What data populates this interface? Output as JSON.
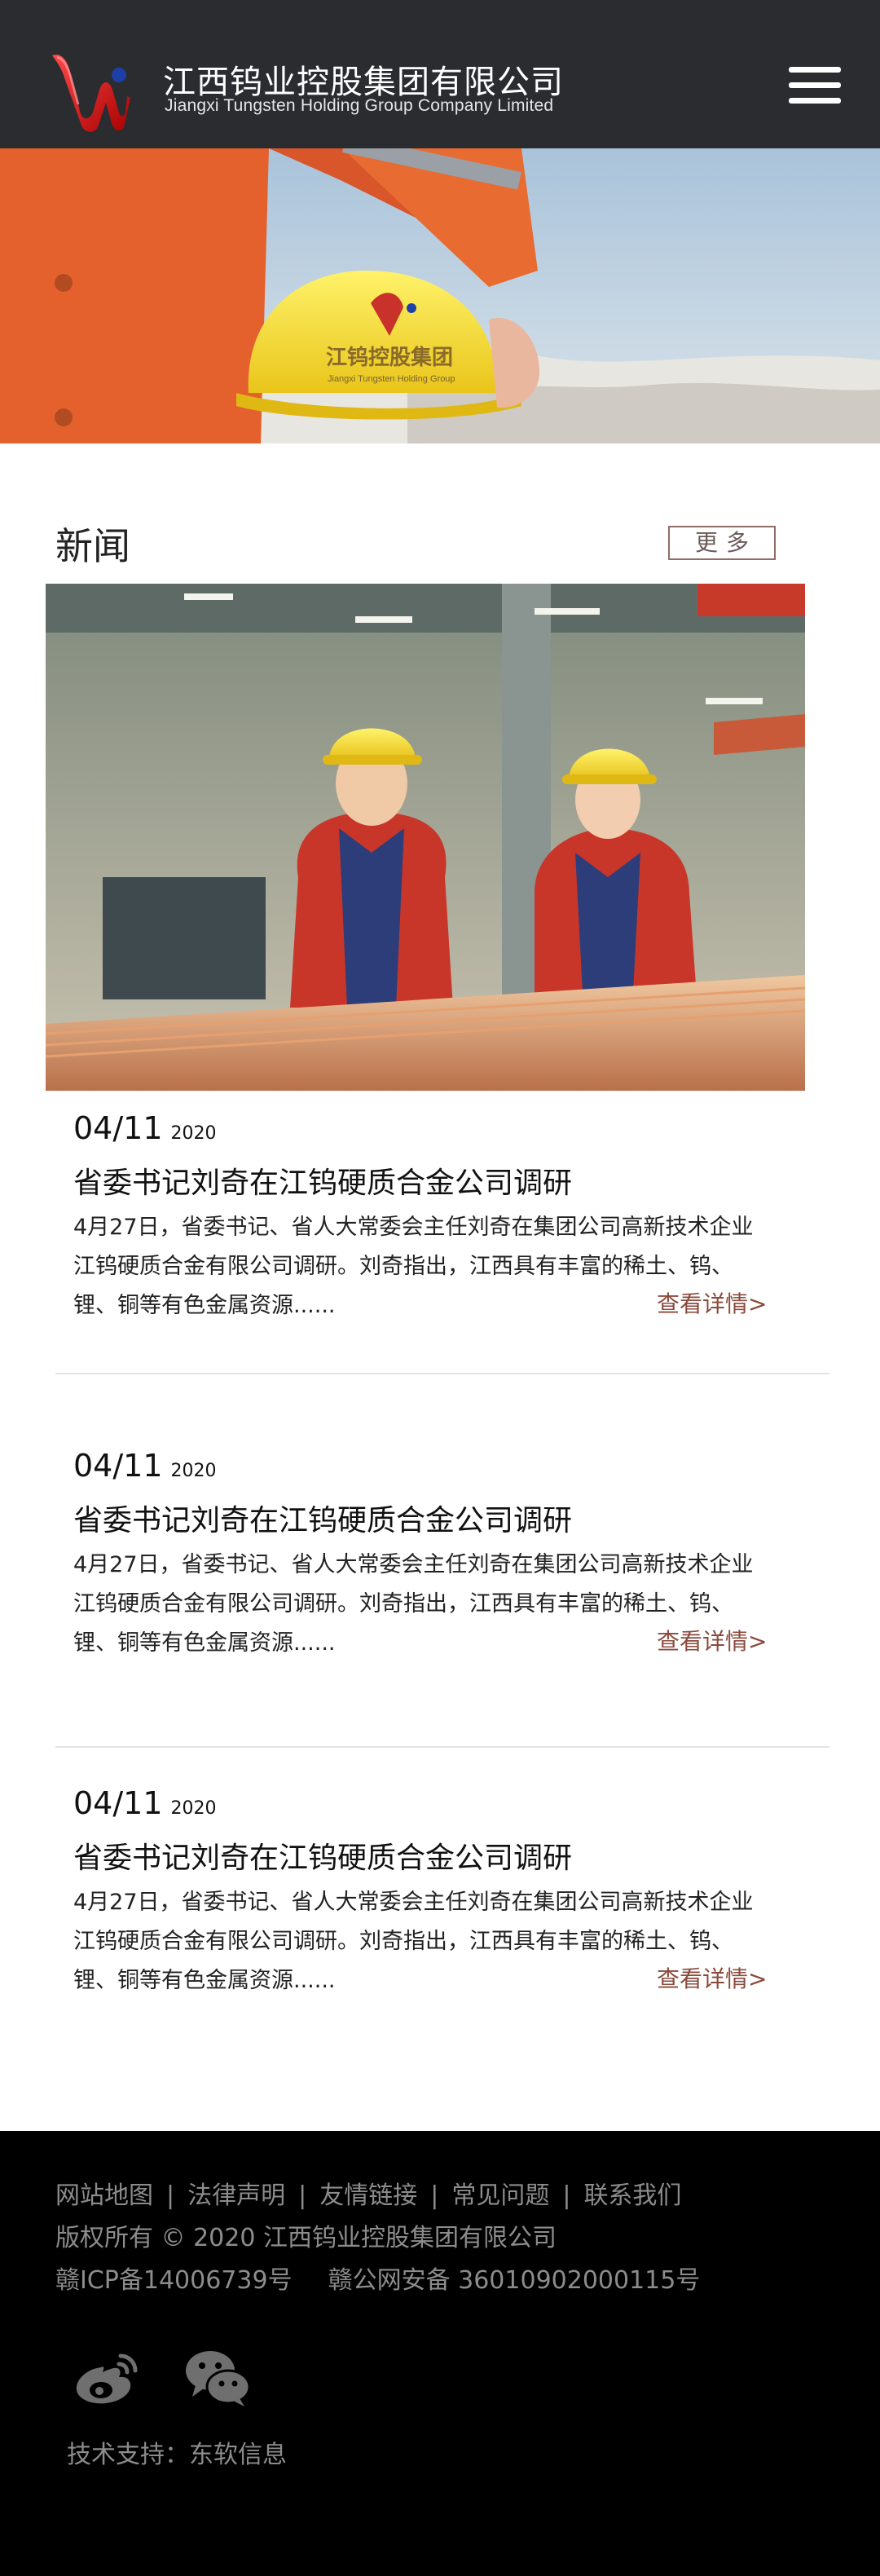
{
  "header": {
    "company_cn": "江西钨业控股集团有限公司",
    "company_en": "Jiangxi Tungsten Holding Group Company Limited",
    "helmet_text": "江钨控股集团",
    "helmet_text_en": "Jiangxi Tungsten Holding Group"
  },
  "news": {
    "title": "新闻",
    "more_label": "更多",
    "items": [
      {
        "date": "04/11",
        "year": "2020",
        "title": "省委书记刘奇在江钨硬质合金公司调研",
        "summary": "4月27日，省委书记、省人大常委会主任刘奇在集团公司高新技术企业江钨硬质合金有限公司调研。刘奇指出，江西具有丰富的稀土、钨、锂、铜等有色金属资源......",
        "more": "查看详情>"
      },
      {
        "date": "04/11",
        "year": "2020",
        "title": "省委书记刘奇在江钨硬质合金公司调研",
        "summary": "4月27日，省委书记、省人大常委会主任刘奇在集团公司高新技术企业江钨硬质合金有限公司调研。刘奇指出，江西具有丰富的稀土、钨、锂、铜等有色金属资源......",
        "more": "查看详情>"
      },
      {
        "date": "04/11",
        "year": "2020",
        "title": "省委书记刘奇在江钨硬质合金公司调研",
        "summary": "4月27日，省委书记、省人大常委会主任刘奇在集团公司高新技术企业江钨硬质合金有限公司调研。刘奇指出，江西具有丰富的稀土、钨、锂、铜等有色金属资源......",
        "more": "查看详情>"
      }
    ]
  },
  "footer": {
    "links": [
      "网站地图",
      "法律声明",
      "友情链接",
      "常见问题",
      "联系我们"
    ],
    "separator": "|",
    "copyright": "版权所有 © 2020 江西钨业控股集团有限公司",
    "icp": "赣ICP备14006739号",
    "police": "赣公网安备 36010902000115号",
    "tech_support": "技术支持：东软信息"
  },
  "icons": {
    "logo": "company-logo-icon",
    "menu": "hamburger-menu-icon",
    "weibo": "weibo-icon",
    "wechat": "wechat-icon"
  },
  "colors": {
    "header_bg": "#2b2c30",
    "footer_bg": "#000000",
    "accent_link": "#8a4a3c",
    "more_border": "#8f6d68"
  }
}
